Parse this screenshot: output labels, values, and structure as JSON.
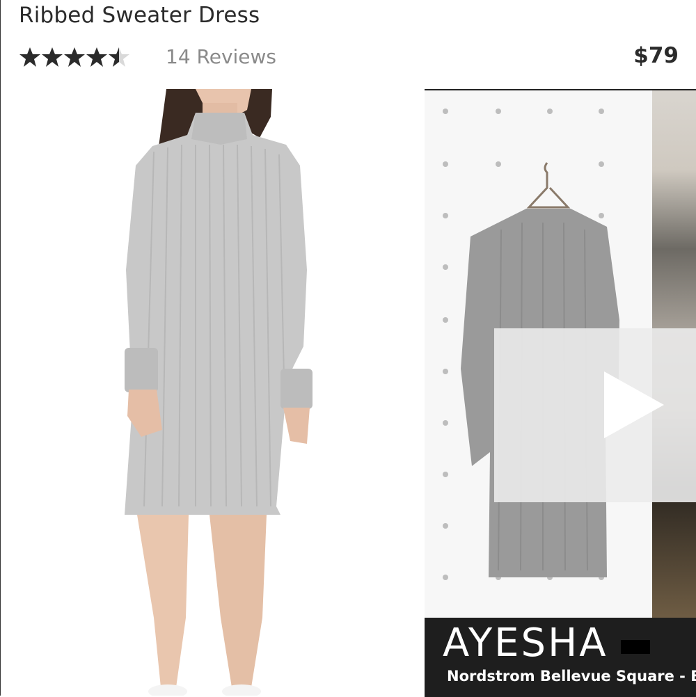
{
  "product": {
    "title": "Ribbed Sweater Dress",
    "rating": 4.5,
    "rating_max": 5,
    "reviews_label": "14 Reviews",
    "price": "$79"
  },
  "video": {
    "caption_name": "AYESHA",
    "caption_store": "Nordstrom Bellevue Square - Bell"
  },
  "colors": {
    "star_filled": "#2b2b2b",
    "star_empty": "#d9d9d9",
    "sweater": "#c8c8c8",
    "caption_bg": "#1e1e1e"
  },
  "icons": {
    "star": "star-icon",
    "play": "play-icon"
  }
}
